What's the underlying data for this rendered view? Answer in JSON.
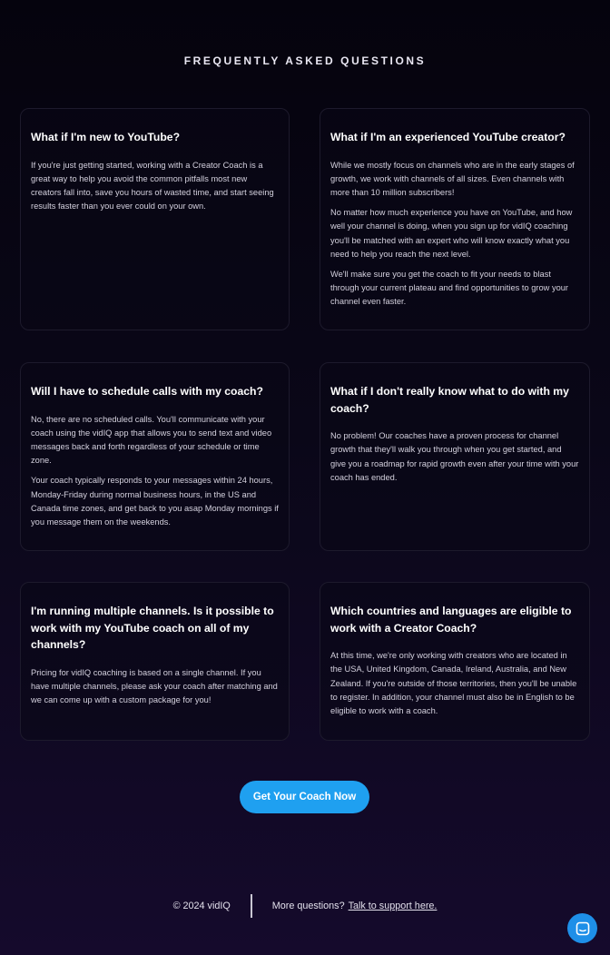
{
  "faq": {
    "heading": "FREQUENTLY ASKED QUESTIONS",
    "items": [
      {
        "question": "What if I'm new to YouTube?",
        "answers": [
          "If you're just getting started, working with a Creator Coach is a great way to help you avoid the common pitfalls most new creators fall into, save you hours of wasted time, and start seeing results faster than you ever could on your own."
        ]
      },
      {
        "question": "What if I'm an experienced YouTube creator?",
        "answers": [
          "While we mostly focus on channels who are in the early stages of growth, we work with channels of all sizes. Even channels with more than 10 million subscribers!",
          "No matter how much experience you have on YouTube, and how well your channel is doing, when you sign up for vidIQ coaching you'll be matched with an expert who will know exactly what you need to help you reach the next level.",
          "We'll make sure you get the coach to fit your needs to blast through your current plateau and find opportunities to grow your channel even faster."
        ]
      },
      {
        "question": "Will I have to schedule calls with my coach?",
        "answers": [
          "No, there are no scheduled calls. You'll communicate with your coach using the vidIQ app that allows you to send text and video messages back and forth regardless of your schedule or time zone.",
          "Your coach typically responds to your messages within 24 hours, Monday-Friday during normal business hours, in the US and Canada time zones, and get back to you asap Monday mornings if you message them on the weekends."
        ]
      },
      {
        "question": "What if I don't really know what to do with my coach?",
        "answers": [
          "No problem!  Our coaches have a proven process for channel growth that they'll walk you through when you get started, and give you a roadmap for rapid growth even after your time with your coach has ended."
        ]
      },
      {
        "question": "I'm running multiple channels.  Is it possible to work with my YouTube coach on all of my channels?",
        "answers": [
          "Pricing for vidIQ coaching is based on a single channel.  If you have multiple channels, please ask your coach after matching and we can come up with a custom package for you!"
        ]
      },
      {
        "question": "Which countries and languages are eligible to work with a Creator Coach?",
        "answers": [
          "At this time, we're only working with creators who are located in the USA, United Kingdom, Canada, Ireland, Australia, and New Zealand.  If you're outside of those territories, then you'll be unable to register. In addition, your channel must also be in English to be eligible to work with a coach."
        ]
      }
    ]
  },
  "cta": {
    "label": "Get Your Coach Now"
  },
  "footer": {
    "copyright": "© 2024 vidIQ",
    "more_questions": "More questions?",
    "support_link": "Talk to support here."
  },
  "chat": {
    "icon": "chat-bubble-icon"
  },
  "colors": {
    "accent": "#1fa0f0",
    "chat": "#1e8fe8"
  }
}
